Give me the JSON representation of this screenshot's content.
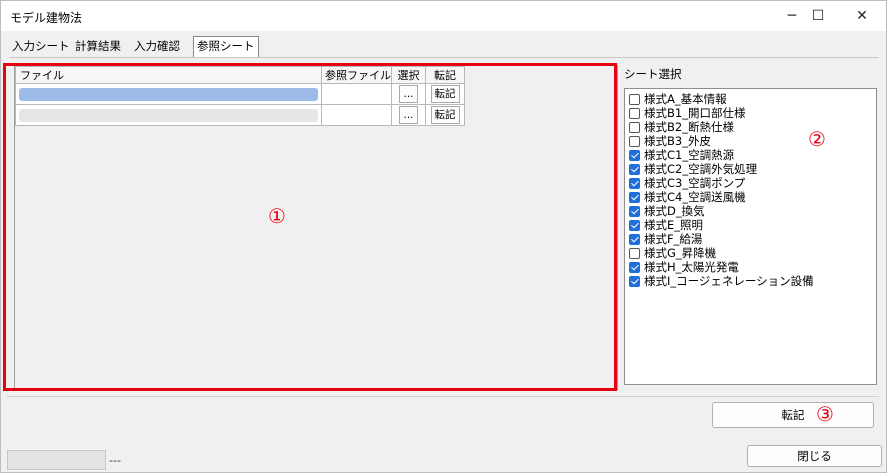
{
  "window": {
    "title": "モデル建物法",
    "minimize": "─",
    "maximize": "☐",
    "close": "✕"
  },
  "tabs": [
    {
      "label": "入力シート",
      "active": false
    },
    {
      "label": "計算結果",
      "active": false
    },
    {
      "label": "入力確認",
      "active": false
    },
    {
      "label": "参照シート",
      "active": true
    }
  ],
  "file_grid": {
    "headers": {
      "file": "ファイル",
      "ref_file": "参照ファイル",
      "select": "選択",
      "transfer": "転記"
    },
    "rows": [
      {
        "select_label": "...",
        "transfer_label": "転記",
        "selected": true
      },
      {
        "select_label": "...",
        "transfer_label": "転記",
        "selected": false
      }
    ]
  },
  "sheet_select": {
    "label": "シート選択",
    "items": [
      {
        "label": "様式A_基本情報",
        "checked": false
      },
      {
        "label": "様式B1_開口部仕様",
        "checked": false
      },
      {
        "label": "様式B2_断熱仕様",
        "checked": false
      },
      {
        "label": "様式B3_外皮",
        "checked": false
      },
      {
        "label": "様式C1_空調熱源",
        "checked": true
      },
      {
        "label": "様式C2_空調外気処理",
        "checked": true
      },
      {
        "label": "様式C3_空調ポンプ",
        "checked": true
      },
      {
        "label": "様式C4_空調送風機",
        "checked": true
      },
      {
        "label": "様式D_換気",
        "checked": true
      },
      {
        "label": "様式E_照明",
        "checked": true
      },
      {
        "label": "様式F_給湯",
        "checked": true
      },
      {
        "label": "様式G_昇降機",
        "checked": false
      },
      {
        "label": "様式H_太陽光発電",
        "checked": true
      },
      {
        "label": "様式I_コージェネレーション設備",
        "checked": true
      }
    ]
  },
  "annotations": {
    "one": "①",
    "two": "②",
    "three": "③"
  },
  "buttons": {
    "transfer": "転記",
    "close": "閉じる"
  },
  "status": {
    "text": "---"
  },
  "colors": {
    "accent": "#1e6fd9",
    "highlight_frame": "#e60012"
  }
}
